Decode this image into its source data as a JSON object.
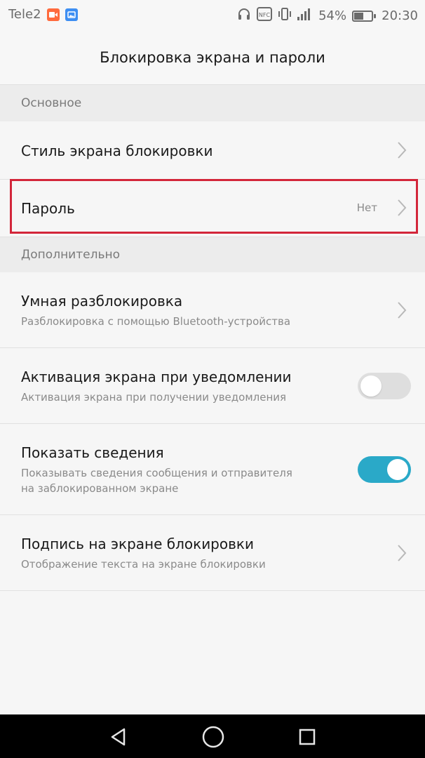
{
  "status_bar": {
    "carrier": "Tele2",
    "battery_percent": "54%",
    "battery_level": 0.54,
    "time": "20:30",
    "nfc_label": "NFC",
    "icons": [
      "screen-recorder-icon",
      "gallery-icon",
      "headphones-icon",
      "nfc-icon",
      "vibrate-icon",
      "signal-icon",
      "battery-icon"
    ]
  },
  "header": {
    "title": "Блокировка экрана и пароли"
  },
  "sections": [
    {
      "title": "Основное",
      "items": [
        {
          "label": "Стиль экрана блокировки",
          "control": "chevron"
        },
        {
          "label": "Пароль",
          "value": "Нет",
          "control": "chevron"
        }
      ]
    },
    {
      "title": "Дополнительно",
      "items": [
        {
          "label": "Умная разблокировка",
          "subtitle": "Разблокировка с помощью Bluetooth-устройства",
          "control": "chevron"
        },
        {
          "label": "Активация экрана при уведомлении",
          "subtitle": "Активация экрана при получении уведомления",
          "control": "toggle",
          "state": "off"
        },
        {
          "label": "Показать сведения",
          "subtitle_line1": "Показывать сведения сообщения и отправителя",
          "subtitle_line2": "на заблокированном экране",
          "control": "toggle",
          "state": "on"
        },
        {
          "label": "Подпись на экране блокировки",
          "subtitle": "Отображение текста на экране блокировки",
          "control": "chevron"
        }
      ]
    }
  ],
  "nav_bar": {
    "icons": [
      "back-icon",
      "home-icon",
      "recents-icon"
    ]
  },
  "colors": {
    "accent": "#2aa9c8",
    "highlight": "#d3263a",
    "background": "#f6f6f6",
    "section_background": "#ececec"
  }
}
